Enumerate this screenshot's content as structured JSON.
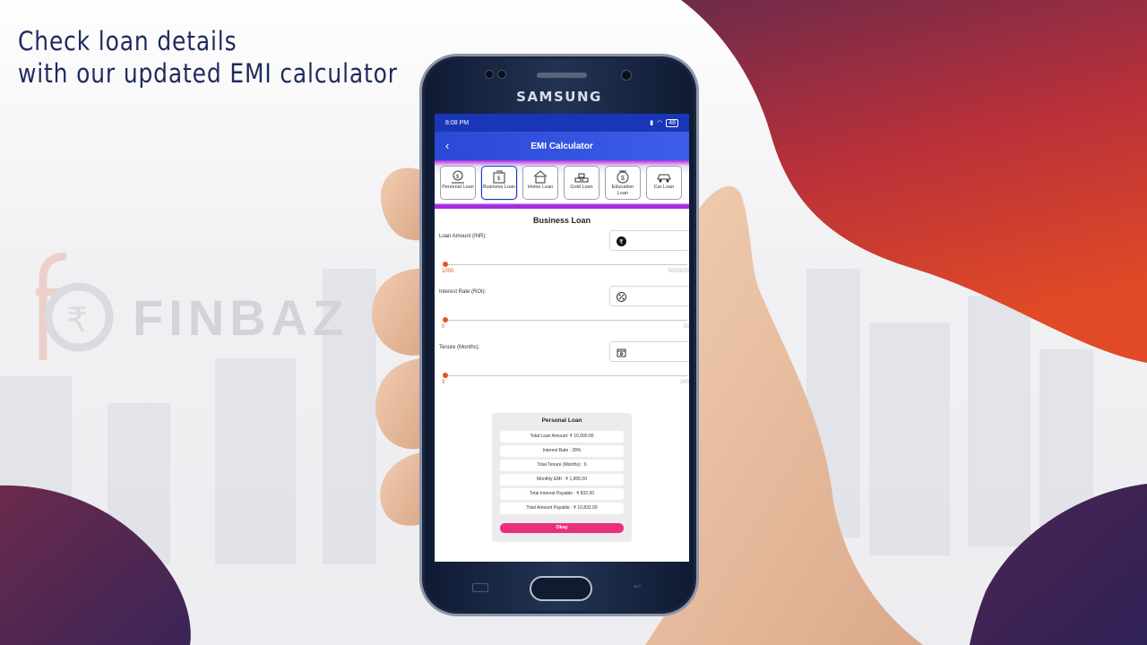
{
  "promo": {
    "headline_line1": "Check loan details",
    "headline_line2": "with our updated EMI calculator",
    "logo_text": "FINBAZ"
  },
  "device": {
    "brand": "SAMSUNG"
  },
  "status_bar": {
    "time": "8:08 PM",
    "battery": "48"
  },
  "app_bar": {
    "title": "EMI Calculator"
  },
  "loan_tabs": [
    {
      "label": "Personal Loan",
      "icon": "personal-loan-icon"
    },
    {
      "label": "Business Loan",
      "icon": "business-loan-icon",
      "active": true
    },
    {
      "label": "Home Loan",
      "icon": "home-loan-icon"
    },
    {
      "label": "Gold Loan",
      "icon": "gold-loan-icon"
    },
    {
      "label": "Education Loan",
      "icon": "education-loan-icon"
    },
    {
      "label": "Car Loan",
      "icon": "car-loan-icon"
    }
  ],
  "form": {
    "section_title": "Business Loan",
    "loan_amount": {
      "label": "Loan Amount (INR):",
      "icon": "rupee-icon",
      "slider_min": "1000",
      "slider_max": "5000000",
      "slider_fraction": 0.0
    },
    "interest_rate": {
      "label": "Interest Rate (ROI):",
      "icon": "interest-rate-icon",
      "slider_min": "0",
      "slider_max": "50",
      "slider_fraction": 0.0
    },
    "tenure": {
      "label": "Tenure (Months):",
      "icon": "calendar-icon",
      "slider_min": "3",
      "slider_max": "240",
      "slider_fraction": 0.0
    }
  },
  "result": {
    "title": "Personal Loan",
    "rows": [
      "Total Loan Amount: ₹ 10,000.00",
      "Interest Rate : 28%",
      "Total Tenure (Months) : 6",
      "Monthly EMI : ₹ 1,805.00",
      "Total Interest Payable : ₹ 832.00",
      "Total Amount Payable : ₹ 10,832.00"
    ],
    "okay_label": "Okay"
  },
  "colors": {
    "headline": "#1e2a5c",
    "app_bar": "#2c48d6",
    "slider_accent": "#e5551f",
    "okay_button": "#e8307d",
    "shape_gradient_top": "#6e2a4a",
    "shape_gradient_bottom": "#d9402a"
  }
}
